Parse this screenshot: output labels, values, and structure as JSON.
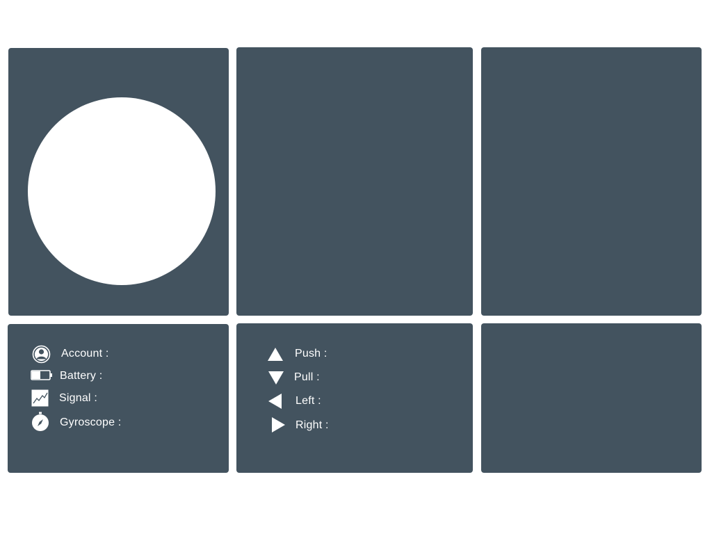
{
  "status": {
    "items": [
      {
        "icon": "account-icon",
        "label": "Account :"
      },
      {
        "icon": "battery-icon",
        "label": "Battery :"
      },
      {
        "icon": "signal-icon",
        "label": "Signal :"
      },
      {
        "icon": "compass-icon",
        "label": "Gyroscope :"
      }
    ]
  },
  "controls": {
    "items": [
      {
        "icon": "arrow-up-icon",
        "label": "Push :"
      },
      {
        "icon": "arrow-down-icon",
        "label": "Pull :"
      },
      {
        "icon": "arrow-left-icon",
        "label": "Left :"
      },
      {
        "icon": "arrow-right-icon",
        "label": "Right :"
      }
    ]
  },
  "colors": {
    "panel": "#43535f",
    "background": "#ffffff",
    "foreground": "#ffffff"
  }
}
